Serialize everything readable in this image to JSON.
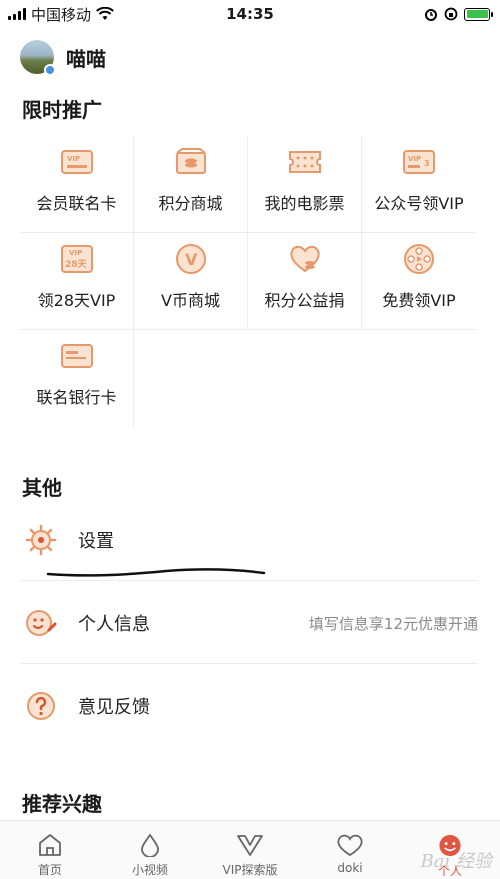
{
  "status_bar": {
    "carrier": "中国移动",
    "time": "14:35"
  },
  "profile": {
    "username": "喵喵"
  },
  "promo": {
    "title": "限时推广",
    "items": [
      {
        "label": "会员联名卡",
        "icon": "vip-card-icon"
      },
      {
        "label": "积分商城",
        "icon": "points-mall-icon"
      },
      {
        "label": "我的电影票",
        "icon": "movie-ticket-icon"
      },
      {
        "label": "公众号领VIP",
        "icon": "official-account-vip-icon"
      },
      {
        "label": "领28天VIP",
        "icon": "vip-28-day-icon"
      },
      {
        "label": "V币商城",
        "icon": "v-coin-icon"
      },
      {
        "label": "积分公益捐",
        "icon": "charity-heart-icon"
      },
      {
        "label": "免费领VIP",
        "icon": "free-vip-film-icon"
      },
      {
        "label": "联名银行卡",
        "icon": "bank-card-icon"
      }
    ],
    "icon_text": {
      "vip": "VIP",
      "vip3": "3",
      "days": "28天",
      "v": "V"
    }
  },
  "other": {
    "title": "其他",
    "settings": "设置",
    "personal_info": "个人信息",
    "personal_info_hint": "填写信息享12元优惠开通",
    "feedback": "意见反馈"
  },
  "recommend": {
    "title": "推荐兴趣"
  },
  "tabbar": [
    {
      "label": "首页",
      "icon": "home-icon"
    },
    {
      "label": "小视频",
      "icon": "droplet-icon"
    },
    {
      "label": "VIP探索版",
      "icon": "vip-explore-icon"
    },
    {
      "label": "doki",
      "icon": "doki-heart-icon"
    },
    {
      "label": "个人",
      "icon": "profile-face-icon"
    }
  ],
  "watermark": "Bai 经验",
  "colors": {
    "accent": "#e69a6b",
    "active_tab": "#e2553e",
    "battery": "#3ac24a"
  }
}
